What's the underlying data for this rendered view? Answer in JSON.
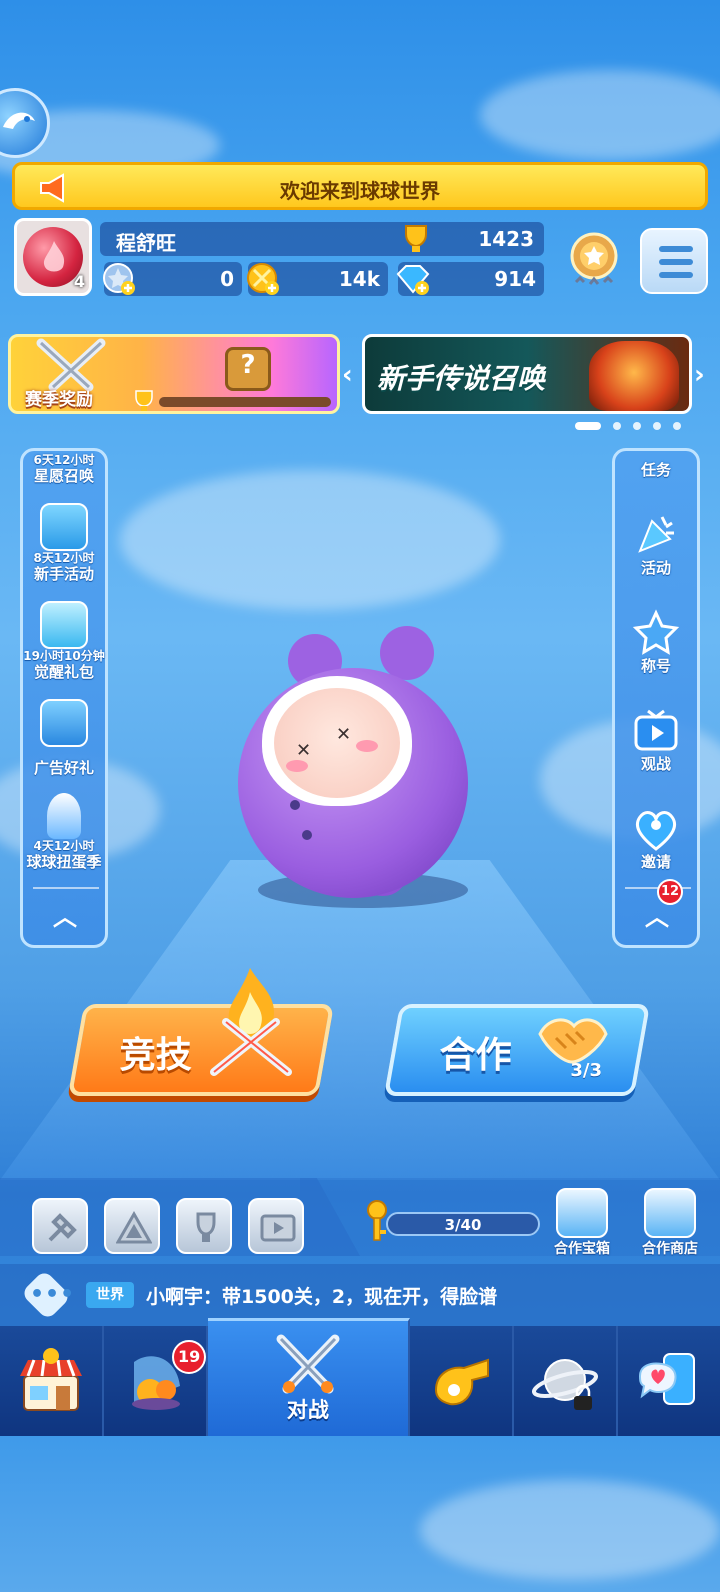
{
  "notice": {
    "text": "欢迎来到球球世界"
  },
  "profile": {
    "level": "4",
    "name": "程舒旺",
    "trophies": "1423",
    "stars": "0",
    "coins": "14k",
    "gems": "914"
  },
  "banners": {
    "season_label": "赛季奖励",
    "season_box_mark": "?",
    "summon_label": "新手传说召唤",
    "page_count": 5,
    "active_page": 1
  },
  "left_panel": {
    "items": [
      {
        "timer": "6天12小时",
        "label": "星愿召唤"
      },
      {
        "timer": "8天12小时",
        "label": "新手活动"
      },
      {
        "timer": "19小时10分钟",
        "label": "觉醒礼包"
      },
      {
        "timer": "",
        "label": "广告好礼"
      },
      {
        "timer": "4天12小时",
        "label": "球球扭蛋季"
      }
    ],
    "collapse_icon": "chevron-up-icon"
  },
  "right_panel": {
    "items": [
      {
        "label": "任务"
      },
      {
        "label": "活动"
      },
      {
        "label": "称号"
      },
      {
        "label": "观战"
      },
      {
        "label": "邀请"
      }
    ],
    "badge": "12",
    "collapse_icon": "chevron-up-icon"
  },
  "modes": {
    "compete_label": "竞技",
    "coop_label": "合作",
    "coop_count": "3/3"
  },
  "tray": {
    "key_progress": "3/40",
    "coop_chest_label": "合作宝箱",
    "coop_shop_label": "合作商店"
  },
  "chat": {
    "channel": "世界",
    "message": "小啊宇：带1500关，2，现在开，得脸谱",
    "button_dots": "•••"
  },
  "nav": {
    "items": [
      {
        "icon": "shop-icon",
        "label": ""
      },
      {
        "icon": "ball-collection-icon",
        "label": "",
        "badge": "19"
      },
      {
        "icon": "crossed-swords-icon",
        "label": "对战",
        "active": true
      },
      {
        "icon": "whistle-icon",
        "label": ""
      },
      {
        "icon": "planet-icon",
        "label": "",
        "locked": true
      },
      {
        "icon": "social-chat-icon",
        "label": ""
      }
    ]
  },
  "colors": {
    "notice_bg": "#ffd42a",
    "compete_orange": "#ff8a1e",
    "coop_blue": "#2a8ef0",
    "nav_bg": "#0d2f6e",
    "badge_red": "#e8202e"
  }
}
